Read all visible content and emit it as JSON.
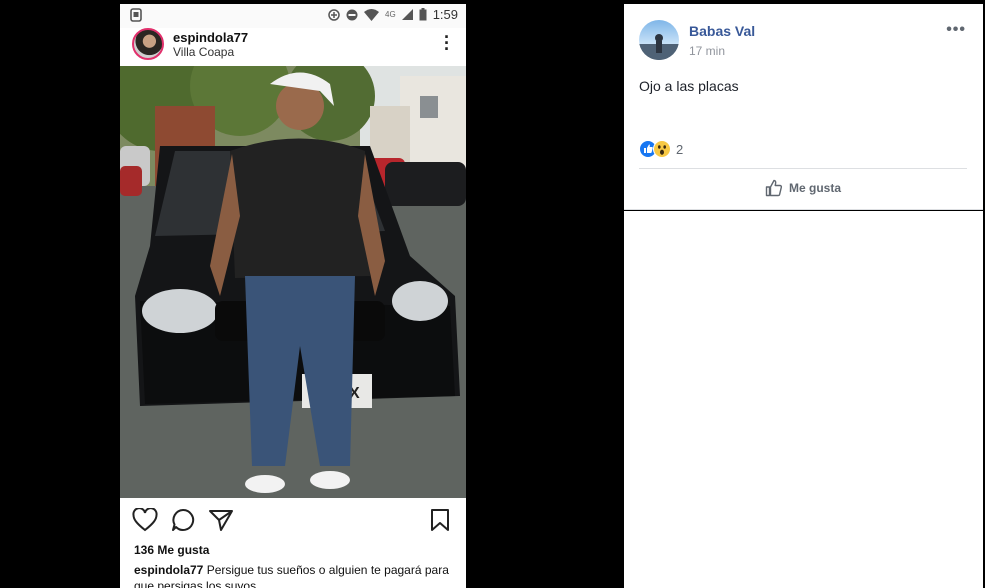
{
  "phone": {
    "status_bar": {
      "time": "1:59",
      "network": "4G"
    },
    "instagram": {
      "username": "espindola77",
      "location": "Villa Coapa",
      "likes": "136 Me gusta",
      "caption_user": "espindola77",
      "caption_text": "Persigue tus sueños o alguien te pagará para que persigas los suyos",
      "plate_text": "7 ZRX"
    }
  },
  "facebook_post": {
    "author": "Babas Val",
    "time": "17 min",
    "text": "Ojo a las placas",
    "reaction_count": "2",
    "reactions": [
      "like-icon",
      "wow-icon"
    ],
    "like_button": "Me gusta"
  },
  "colors": {
    "fb_link": "#385898",
    "fb_like": "#1877f2",
    "fb_wow": "#f7c844",
    "background": "#000000"
  }
}
